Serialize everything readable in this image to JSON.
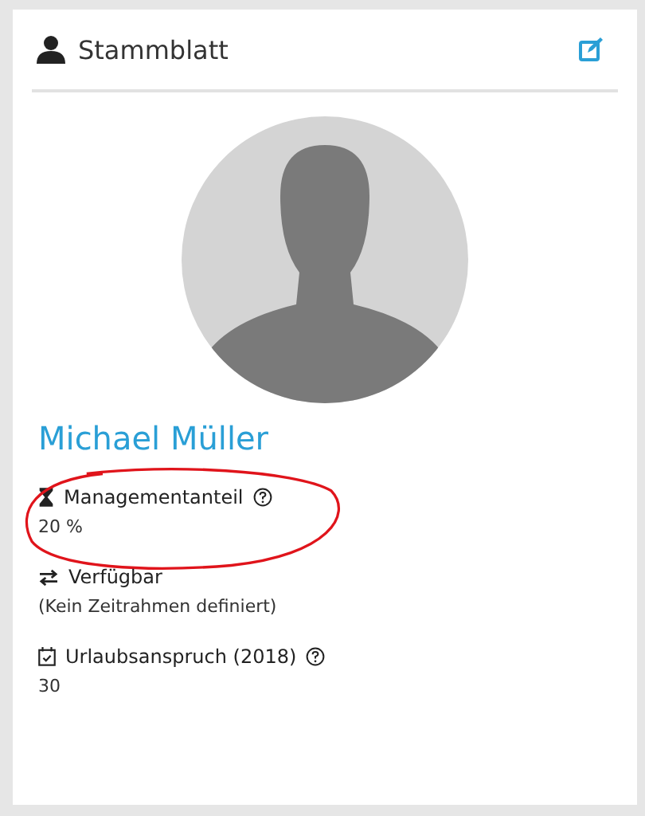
{
  "card": {
    "title": "Stammblatt"
  },
  "profile": {
    "name": "Michael Müller"
  },
  "fields": [
    {
      "kind": "hourglass",
      "label": "Managementanteil",
      "help": true,
      "value": "20 %",
      "highlighted": true
    },
    {
      "kind": "swap",
      "label": "Verfügbar",
      "help": false,
      "value": "(Kein Zeitrahmen definiert)",
      "highlighted": false
    },
    {
      "kind": "calendar",
      "label": "Urlaubsanspruch (2018)",
      "help": true,
      "value": "30",
      "highlighted": false
    }
  ]
}
